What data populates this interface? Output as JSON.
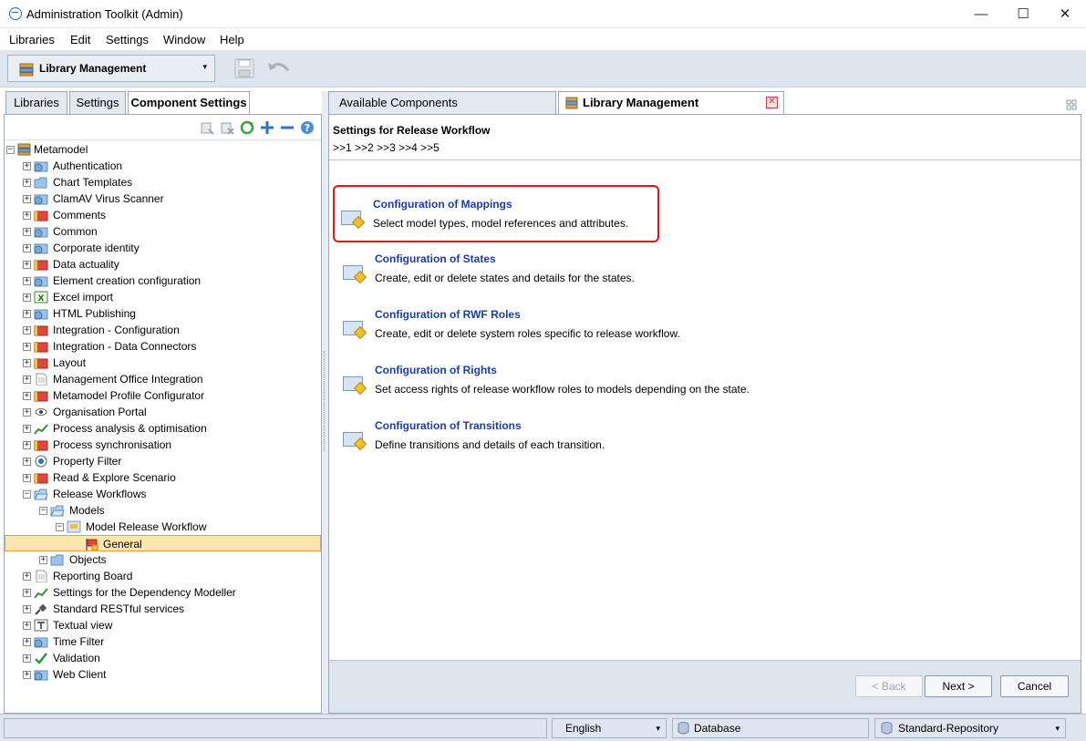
{
  "window": {
    "title": "Administration Toolkit (Admin)"
  },
  "menu": [
    "Libraries",
    "Edit",
    "Settings",
    "Window",
    "Help"
  ],
  "toolbar": {
    "library_combo": "Library Management"
  },
  "left_tabs": [
    "Libraries",
    "Settings",
    "Component Settings"
  ],
  "tree": {
    "root": "Metamodel",
    "items": [
      {
        "label": "Authentication",
        "icon": "globe-folder-icon"
      },
      {
        "label": "Chart Templates",
        "icon": "folder-icon"
      },
      {
        "label": "ClamAV Virus Scanner",
        "icon": "globe-folder-icon"
      },
      {
        "label": "Comments",
        "icon": "red-folder-icon"
      },
      {
        "label": "Common",
        "icon": "globe-folder-icon"
      },
      {
        "label": "Corporate identity",
        "icon": "globe-folder-icon"
      },
      {
        "label": "Data actuality",
        "icon": "red-folder-icon"
      },
      {
        "label": "Element creation configuration",
        "icon": "globe-folder-icon"
      },
      {
        "label": "Excel import",
        "icon": "excel-icon"
      },
      {
        "label": "HTML Publishing",
        "icon": "globe-folder-icon"
      },
      {
        "label": "Integration - Configuration",
        "icon": "red-folder-icon"
      },
      {
        "label": "Integration - Data Connectors",
        "icon": "red-folder-icon"
      },
      {
        "label": "Layout",
        "icon": "red-folder-icon"
      },
      {
        "label": "Management Office Integration",
        "icon": "document-icon"
      },
      {
        "label": "Metamodel Profile Configurator",
        "icon": "red-folder-icon"
      },
      {
        "label": "Organisation Portal",
        "icon": "eye-icon"
      },
      {
        "label": "Process analysis & optimisation",
        "icon": "chart-icon"
      },
      {
        "label": "Process synchronisation",
        "icon": "red-folder-icon"
      },
      {
        "label": "Property Filter",
        "icon": "filter-icon"
      },
      {
        "label": "Read & Explore Scenario",
        "icon": "red-folder-icon"
      },
      {
        "label": "Release Workflows",
        "icon": "folder-open-icon"
      },
      {
        "label": "Models",
        "icon": "folder-open-icon"
      },
      {
        "label": "Model Release Workflow",
        "icon": "workflow-icon"
      },
      {
        "label": "General",
        "icon": "settings-flag-icon"
      },
      {
        "label": "Objects",
        "icon": "folder-icon"
      },
      {
        "label": "Reporting Board",
        "icon": "document-icon"
      },
      {
        "label": "Settings for the Dependency Modeller",
        "icon": "chart-icon"
      },
      {
        "label": "Standard RESTful services",
        "icon": "plug-icon"
      },
      {
        "label": "Textual view",
        "icon": "text-icon"
      },
      {
        "label": "Time Filter",
        "icon": "globe-folder-icon"
      },
      {
        "label": "Validation",
        "icon": "checkmark-icon"
      },
      {
        "label": "Web Client",
        "icon": "globe-folder-icon"
      }
    ]
  },
  "right_tabs": [
    "Available Components",
    "Library Management"
  ],
  "settings": {
    "heading": "Settings for Release Workflow",
    "steps": ">>1 >>2 >>3 >>4 >>5",
    "items": [
      {
        "title": "Configuration of Mappings",
        "desc": "Select model types, model references and attributes."
      },
      {
        "title": "Configuration of States",
        "desc": "Create, edit or delete states and details for the states."
      },
      {
        "title": "Configuration of RWF Roles",
        "desc": "Create, edit or delete system roles specific to release workflow."
      },
      {
        "title": "Configuration of Rights",
        "desc": "Set access rights of release workflow roles to models depending on the state."
      },
      {
        "title": "Configuration of Transitions",
        "desc": "Define transitions and details of each transition."
      }
    ]
  },
  "buttons": {
    "back": "< Back",
    "next": "Next >",
    "cancel": "Cancel"
  },
  "status": {
    "language": "English",
    "database": "Database",
    "repository": "Standard-Repository"
  }
}
